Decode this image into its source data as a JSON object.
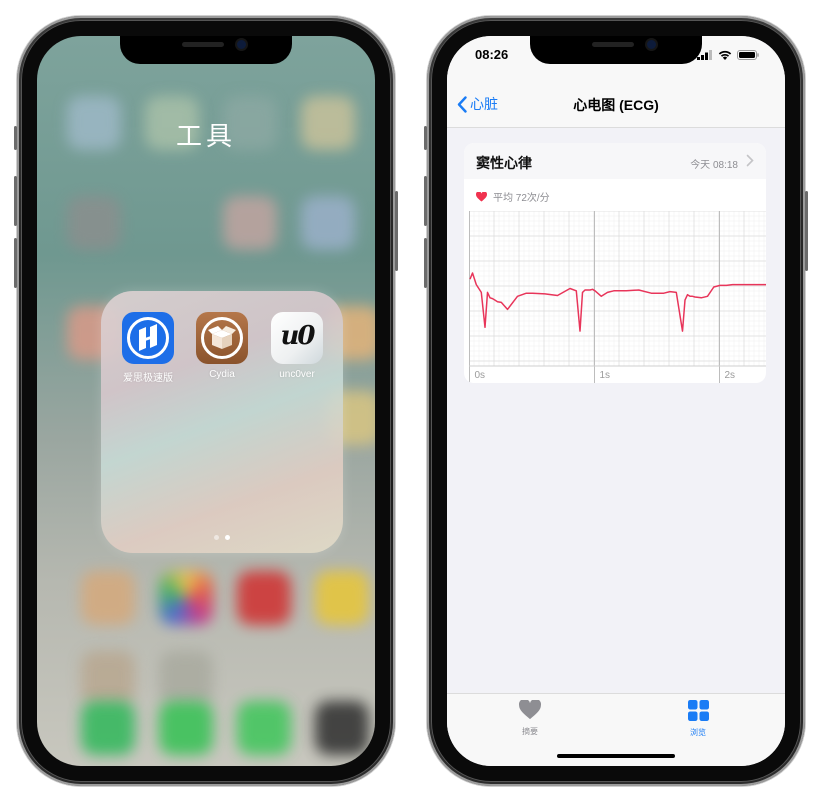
{
  "left_phone": {
    "folder": {
      "title": "工具",
      "apps": [
        {
          "name": "爱思极速版",
          "icon": "aisi-icon"
        },
        {
          "name": "Cydia",
          "icon": "cydia-box-icon"
        },
        {
          "name": "unc0ver",
          "icon": "uncover-u0-icon",
          "glyph": "u0"
        }
      ],
      "pages": 2,
      "active_page": 2
    }
  },
  "right_phone": {
    "status_bar": {
      "time": "08:26",
      "icons": [
        "signal-icon",
        "wifi-icon",
        "battery-icon"
      ]
    },
    "nav": {
      "back_label": "心脏",
      "title": "心电图 (ECG)"
    },
    "ecg_card": {
      "title": "窦性心律",
      "timestamp": "今天 08:18",
      "average_label": "平均 72次/分",
      "heart_color": "#f0324f",
      "trace_color": "#e8355a"
    },
    "tab_bar": {
      "tabs": [
        {
          "label": "摘要",
          "icon": "heart-icon",
          "active": false
        },
        {
          "label": "浏览",
          "icon": "grid-icon",
          "active": true
        }
      ],
      "active_color": "#1a7cf5",
      "inactive_color": "#8e8e93"
    }
  },
  "chart_data": {
    "type": "line",
    "title": "",
    "xlabel": "",
    "ylabel": "",
    "x_ticks": [
      "0s",
      "1s",
      "2s"
    ],
    "xlim": [
      0,
      2.4
    ],
    "ylim": [
      -1,
      1
    ],
    "grid": true,
    "series": [
      {
        "name": "ECG",
        "x": [
          0,
          0.02,
          0.05,
          0.09,
          0.12,
          0.14,
          0.16,
          0.18,
          0.2,
          0.22,
          0.25,
          0.3,
          0.38,
          0.45,
          0.5,
          0.6,
          0.7,
          0.8,
          0.85,
          0.88,
          0.9,
          0.92,
          0.94,
          0.96,
          0.98,
          1.0,
          1.05,
          1.1,
          1.15,
          1.25,
          1.35,
          1.45,
          1.55,
          1.6,
          1.65,
          1.7,
          1.72,
          1.74,
          1.76,
          1.78,
          1.8,
          1.85,
          1.9,
          1.95,
          2.0,
          2.05,
          2.1,
          2.15,
          2.25,
          2.4
        ],
        "y": [
          0.12,
          0.2,
          0.05,
          -0.05,
          -0.5,
          -0.05,
          -0.12,
          -0.13,
          -0.15,
          -0.17,
          -0.18,
          -0.27,
          -0.1,
          -0.06,
          -0.06,
          -0.07,
          -0.09,
          0.0,
          -0.03,
          -0.55,
          -0.05,
          -0.02,
          -0.02,
          -0.02,
          -0.01,
          -0.03,
          -0.1,
          -0.05,
          -0.03,
          -0.03,
          -0.02,
          -0.06,
          -0.06,
          -0.04,
          -0.05,
          -0.55,
          -0.15,
          -0.08,
          -0.1,
          -0.1,
          -0.11,
          -0.12,
          -0.1,
          0.02,
          0.04,
          0.04,
          0.05,
          0.05,
          0.05,
          0.05
        ]
      }
    ]
  }
}
